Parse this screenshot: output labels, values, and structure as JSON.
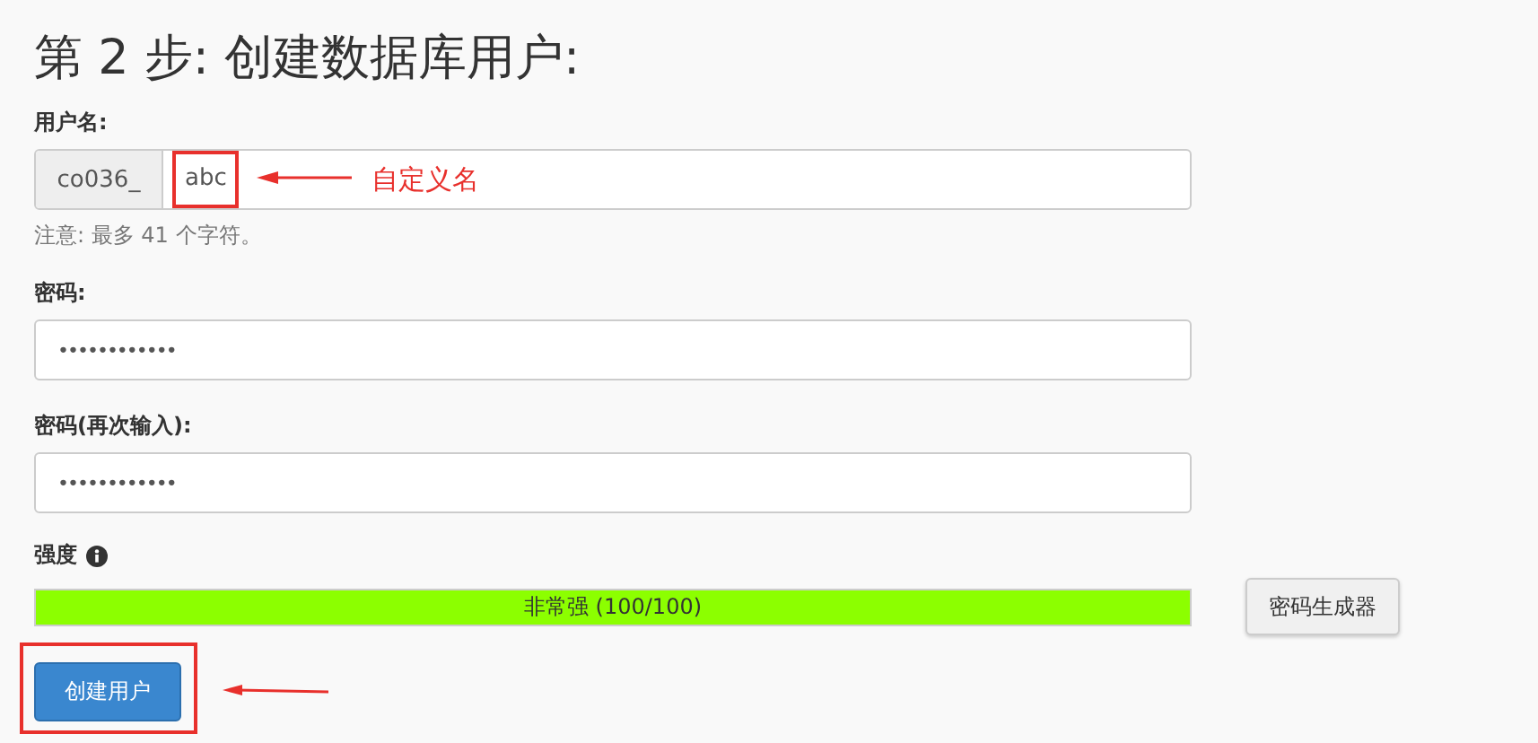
{
  "heading": "第 2 步: 创建数据库用户:",
  "username": {
    "label": "用户名:",
    "prefix": "co036_",
    "value": "abc",
    "note": "注意: 最多 41 个字符。"
  },
  "password": {
    "label": "密码:",
    "value": "••••••••••••"
  },
  "password_again": {
    "label": "密码(再次输入):",
    "value": "••••••••••••"
  },
  "strength": {
    "label": "强度",
    "level": 1,
    "reading": "非常强 (100/100)"
  },
  "generator_button": "密码生成器",
  "submit_button": "创建用户",
  "annotation": {
    "text": "自定义名"
  }
}
